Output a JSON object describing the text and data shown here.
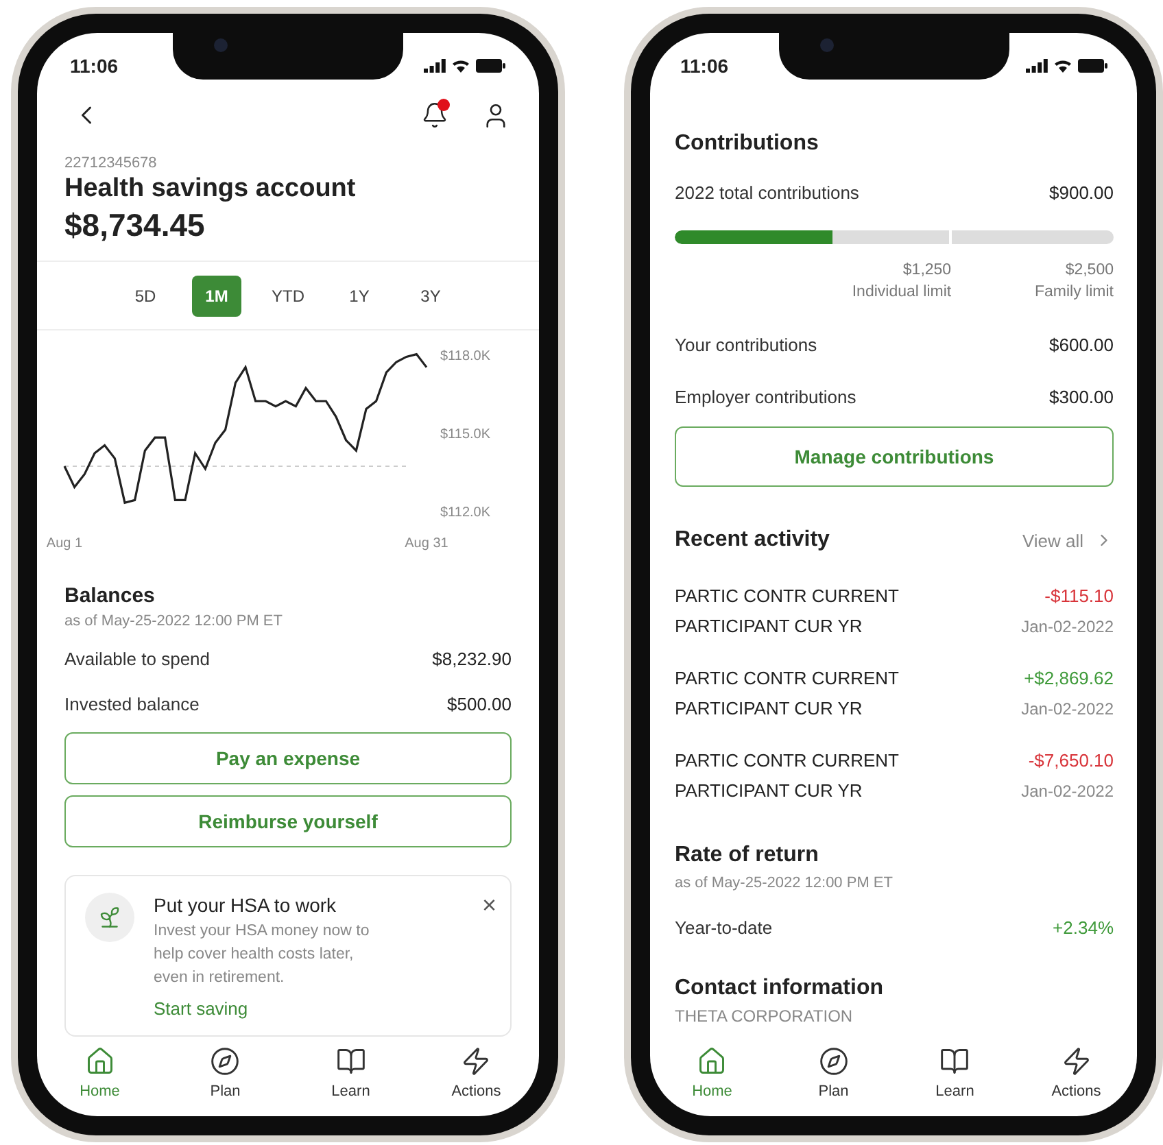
{
  "account_screen": {
    "status_bar": {
      "time": "11:06"
    },
    "header": {
      "notifications_unread": true
    },
    "account": {
      "number": "22712345678",
      "title": "Health savings account",
      "balance": "$8,734.45"
    },
    "periods": [
      {
        "label": "5D",
        "selected": false
      },
      {
        "label": "1M",
        "selected": true
      },
      {
        "label": "YTD",
        "selected": false
      },
      {
        "label": "1Y",
        "selected": false
      },
      {
        "label": "3Y",
        "selected": false
      }
    ],
    "chart_data": {
      "type": "line",
      "categories": [
        "Aug 1",
        null,
        null,
        null,
        null,
        null,
        null,
        null,
        null,
        null,
        null,
        null,
        null,
        null,
        null,
        null,
        null,
        null,
        null,
        null,
        null,
        null,
        null,
        null,
        null,
        null,
        null,
        null,
        null,
        null,
        null,
        null,
        null,
        null,
        null,
        null,
        "Aug 31"
      ],
      "series": [
        {
          "color": "#222222",
          "values": [
            113.7,
            112.9,
            113.4,
            114.2,
            114.5,
            114.0,
            112.3,
            112.4,
            114.3,
            114.8,
            114.8,
            112.4,
            112.4,
            114.2,
            113.6,
            114.6,
            115.1,
            116.9,
            117.5,
            116.2,
            116.2,
            116.0,
            116.2,
            116.0,
            116.7,
            116.2,
            116.2,
            115.6,
            114.7,
            114.3,
            115.9,
            116.2,
            117.3,
            117.7,
            117.9,
            118.0,
            117.5
          ]
        }
      ],
      "ylim": [
        112,
        118
      ],
      "yticks": [
        {
          "value": 118,
          "label": "$118.0K"
        },
        {
          "value": 115,
          "label": "$115.0K"
        },
        {
          "value": 112,
          "label": "$112.0K"
        }
      ],
      "ref_lines": [
        {
          "axis": "y",
          "value": 113.7
        }
      ]
    },
    "balances": {
      "title": "Balances",
      "as_of": "as of May-25-2022 12:00 PM ET",
      "rows": [
        {
          "label": "Available to spend",
          "value": "$8,232.90"
        },
        {
          "label": "Invested balance",
          "value": "$500.00"
        }
      ]
    },
    "actions": [
      "Pay an expense",
      "Reimburse yourself"
    ],
    "promo": {
      "title": "Put your HSA to work",
      "body": "Invest your HSA money now to help cover health costs later, even in retirement.",
      "link": "Start saving",
      "close": "×"
    },
    "tab_bar": [
      {
        "label": "Home",
        "selected": true
      },
      {
        "label": "Plan",
        "selected": false
      },
      {
        "label": "Learn",
        "selected": false
      },
      {
        "label": "Actions",
        "selected": false
      }
    ]
  },
  "details_screen": {
    "status_bar": {
      "time": "11:06"
    },
    "contributions": {
      "title": "Contributions",
      "total_label": "2022 total contributions",
      "total_value": "$900.00",
      "progress": {
        "level": 0.36
      },
      "limits": [
        {
          "amount": "$1,250",
          "label": "Individual limit"
        },
        {
          "amount": "$2,500",
          "label": "Family limit"
        }
      ],
      "rows": [
        {
          "label": "Your contributions",
          "value": "$600.00"
        },
        {
          "label": "Employer contributions",
          "value": "$300.00"
        }
      ],
      "button": "Manage contributions"
    },
    "recent_activity": {
      "title": "Recent activity",
      "view_all": "View all",
      "items": [
        {
          "line1": "PARTIC CONTR CURRENT",
          "line2": "PARTICIPANT CUR YR",
          "amount": "-$115.10",
          "date": "Jan-02-2022",
          "kind": "debit"
        },
        {
          "line1": "PARTIC CONTR CURRENT",
          "line2": "PARTICIPANT CUR YR",
          "amount": "+$2,869.62",
          "date": "Jan-02-2022",
          "kind": "credit"
        },
        {
          "line1": "PARTIC CONTR CURRENT",
          "line2": "PARTICIPANT CUR YR",
          "amount": "-$7,650.10",
          "date": "Jan-02-2022",
          "kind": "debit"
        }
      ]
    },
    "rate_of_return": {
      "title": "Rate of return",
      "as_of": "as of May-25-2022 12:00 PM ET",
      "rows": [
        {
          "label": "Year-to-date",
          "value": "+2.34%",
          "kind": "credit"
        }
      ]
    },
    "contact": {
      "title": "Contact information",
      "company": "THETA CORPORATION"
    },
    "tab_bar": [
      {
        "label": "Home",
        "selected": true
      },
      {
        "label": "Plan",
        "selected": false
      },
      {
        "label": "Learn",
        "selected": false
      },
      {
        "label": "Actions",
        "selected": false
      }
    ]
  }
}
